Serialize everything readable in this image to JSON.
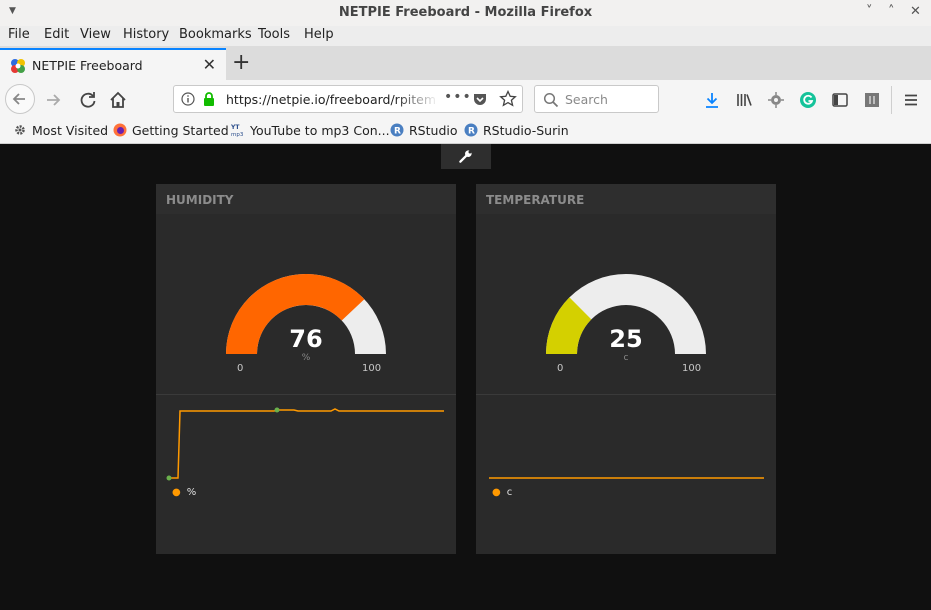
{
  "window": {
    "title": "NETPIE Freeboard - Mozilla Firefox"
  },
  "menu": [
    "File",
    "Edit",
    "View",
    "History",
    "Bookmarks",
    "Tools",
    "Help"
  ],
  "tab": {
    "title": "NETPIE Freeboard"
  },
  "nav": {
    "url": "https://netpie.io/freeboard/rpitem",
    "search_placeholder": "Search"
  },
  "bookmarks": [
    "Most Visited",
    "Getting Started",
    "YouTube to mp3 Con...",
    "RStudio",
    "RStudio-Surin"
  ],
  "colors": {
    "accent": "#0a84ff",
    "humidity_fill": "#ff6600",
    "temperature_fill": "#d4d000",
    "gauge_track": "#ededed",
    "sparkline": "#ff9900",
    "sparkline_marker": "#6ab04c",
    "dashboard_bg": "#101010",
    "pane_bg": "#2a2a2a"
  },
  "panes": [
    {
      "title": "HUMIDITY",
      "gauge": {
        "value": "76",
        "units": "%",
        "min": "0",
        "max": "100",
        "level": 76
      },
      "sparkline": {
        "legend": "%"
      }
    },
    {
      "title": "TEMPERATURE",
      "gauge": {
        "value": "25",
        "units": "c",
        "min": "0",
        "max": "100",
        "level": 25
      },
      "sparkline": {
        "legend": "c"
      }
    }
  ]
}
